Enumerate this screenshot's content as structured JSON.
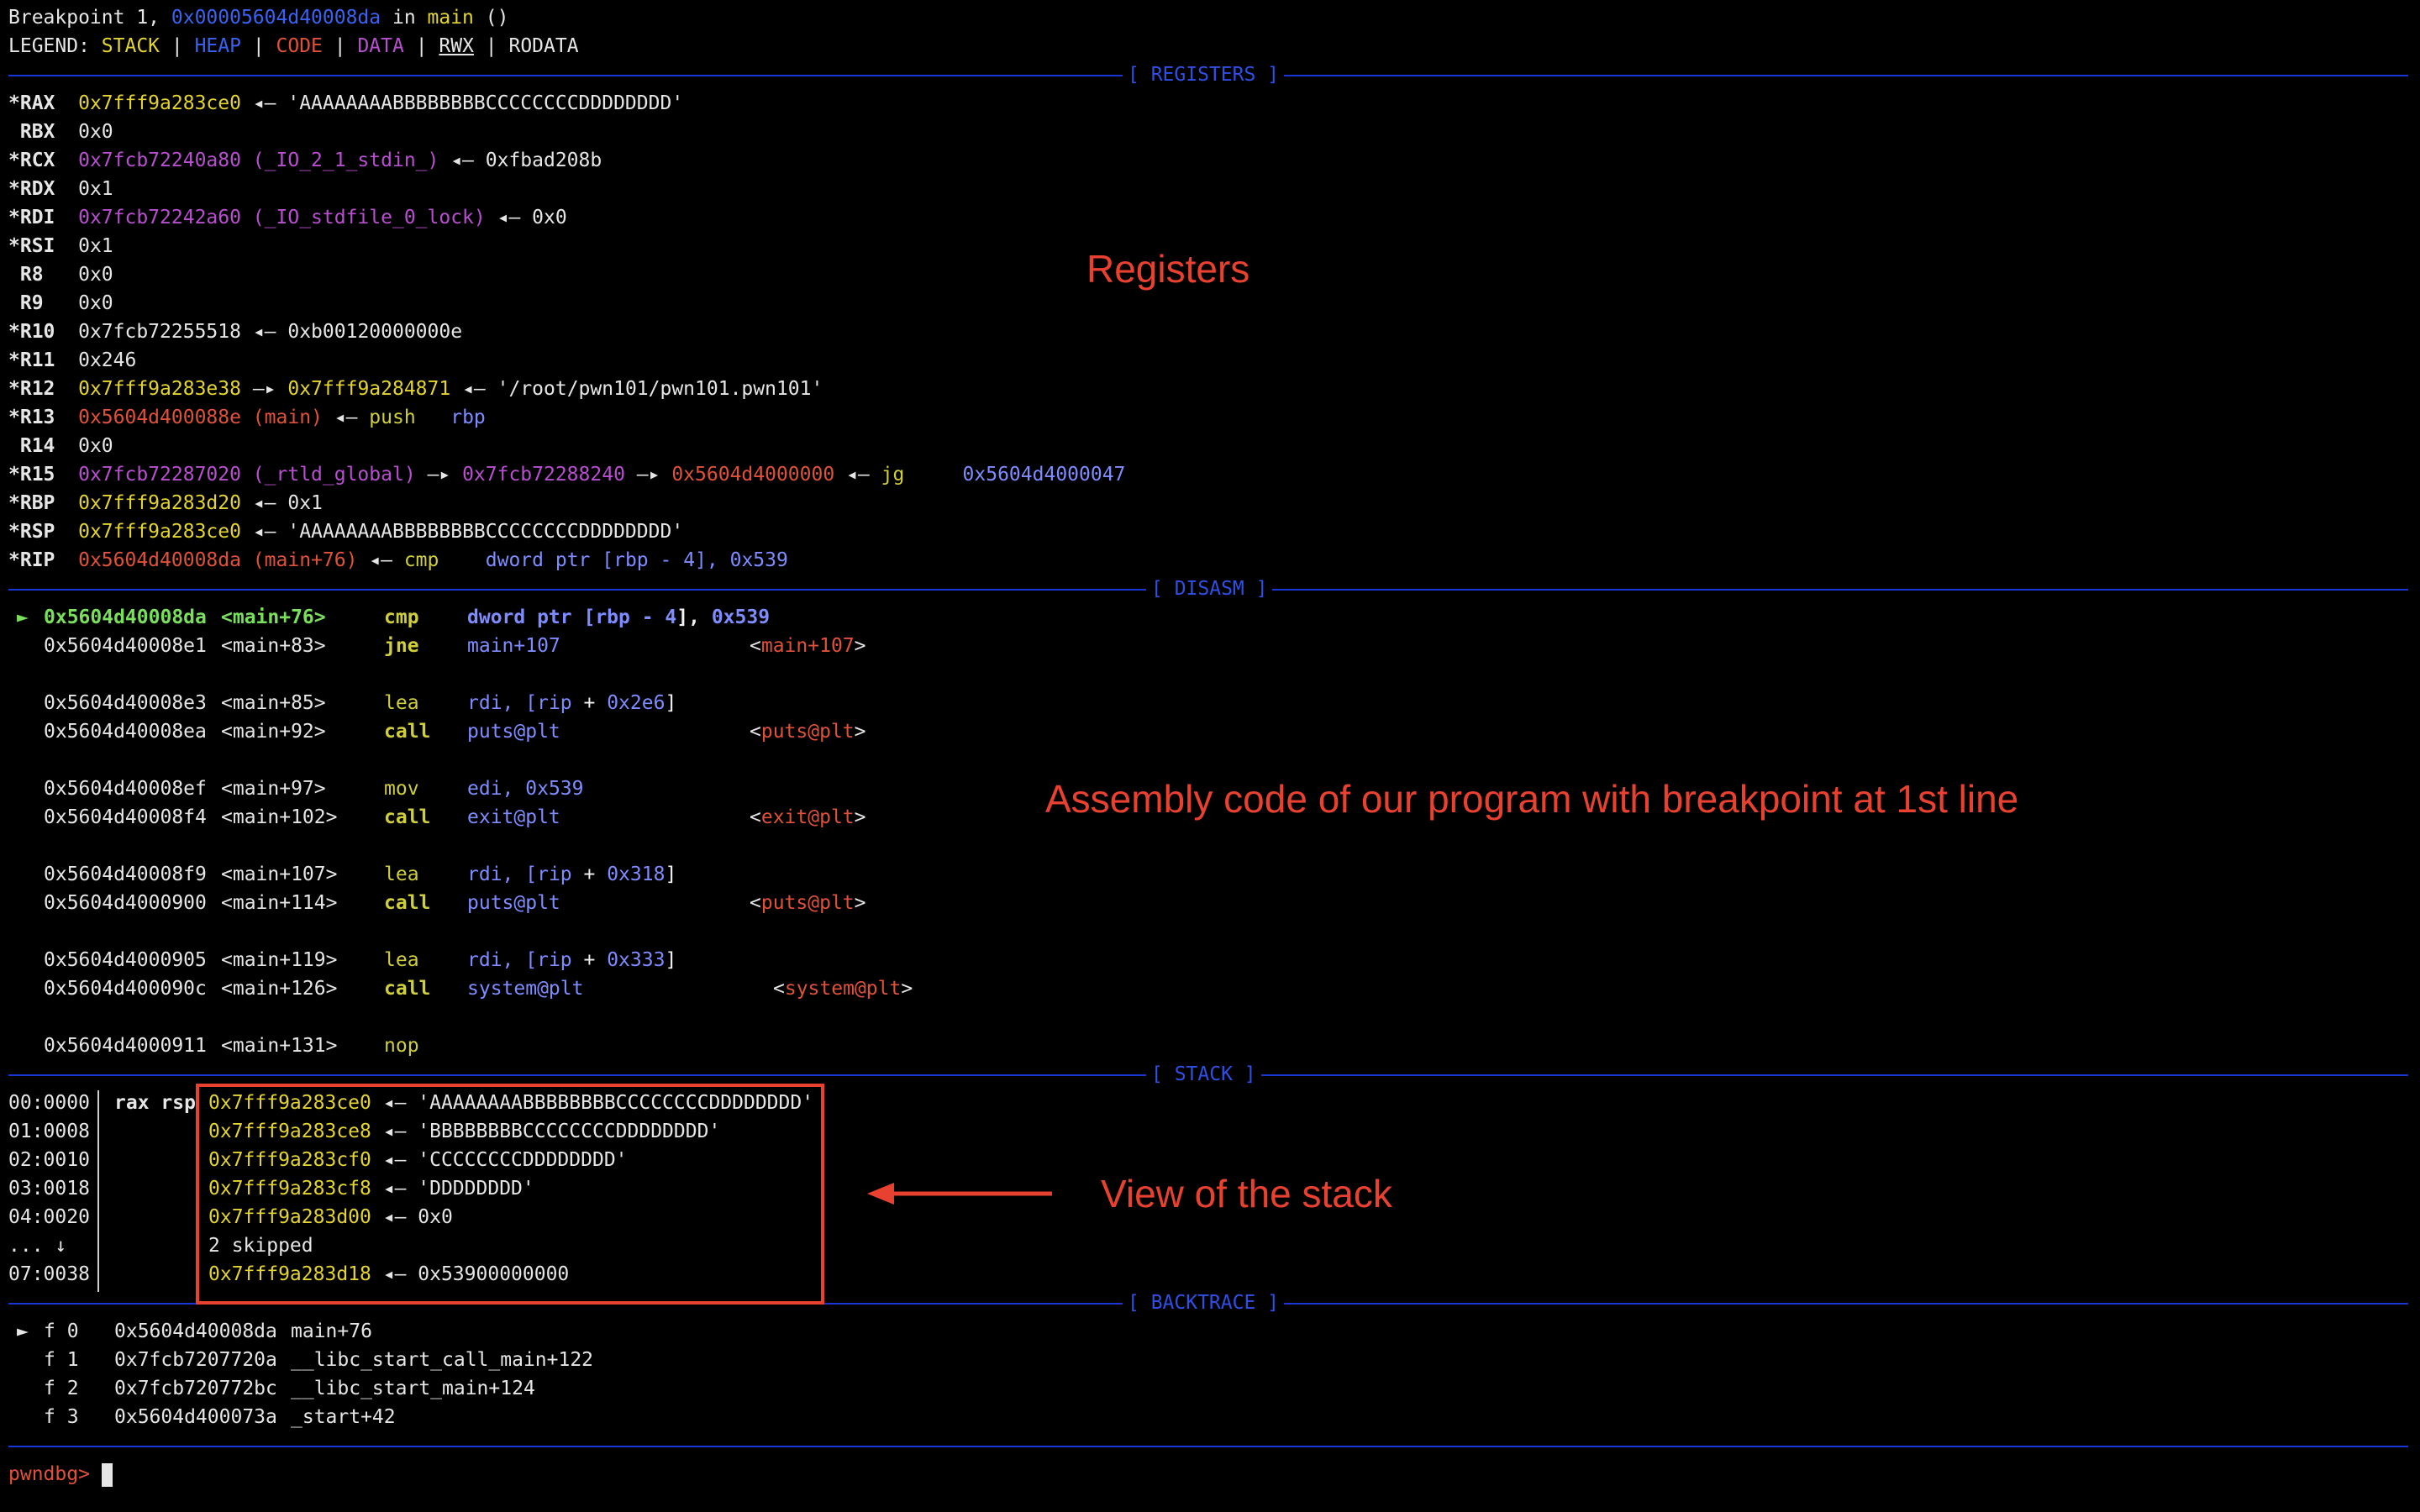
{
  "header": {
    "bp_prefix": "Breakpoint 1, ",
    "bp_addr": "0x00005604d40008da",
    "bp_in": " in ",
    "bp_func": "main",
    "bp_args": " ()",
    "legend_prefix": "LEGEND: ",
    "legend_stack": "STACK",
    "legend_heap": "HEAP",
    "legend_code": "CODE",
    "legend_data": "DATA",
    "legend_rwx": "RWX",
    "legend_rodata": "RODATA",
    "legend_sep": " | "
  },
  "sections": {
    "registers": "[ REGISTERS ]",
    "disasm": "[ DISASM ]",
    "stack": "[ STACK ]",
    "backtrace": "[ BACKTRACE ]"
  },
  "registers": {
    "rax": {
      "name": "*RAX",
      "v1": "0x7fff9a283ce0",
      "arrow": " ◂— ",
      "v2": "'AAAAAAAABBBBBBBBCCCCCCCCDDDDDDDD'"
    },
    "rbx": {
      "name": " RBX",
      "v1": "0x0"
    },
    "rcx": {
      "name": "*RCX",
      "v1": "0x7fcb72240a80 (_IO_2_1_stdin_)",
      "arrow": " ◂— ",
      "v2": "0xfbad208b"
    },
    "rdx": {
      "name": "*RDX",
      "v1": "0x1"
    },
    "rdi": {
      "name": "*RDI",
      "v1": "0x7fcb72242a60 (_IO_stdfile_0_lock)",
      "arrow": " ◂— ",
      "v2": "0x0"
    },
    "rsi": {
      "name": "*RSI",
      "v1": "0x1"
    },
    "r8": {
      "name": " R8",
      "v1": "0x0"
    },
    "r9": {
      "name": " R9",
      "v1": "0x0"
    },
    "r10": {
      "name": "*R10",
      "v1": "0x7fcb72255518",
      "arrow": " ◂— ",
      "v2": "0xb00120000000e"
    },
    "r11": {
      "name": "*R11",
      "v1": "0x246"
    },
    "r12": {
      "name": "*R12",
      "v1": "0x7fff9a283e38",
      "a1": " —▸ ",
      "v2": "0x7fff9a284871",
      "a2": " ◂— ",
      "v3": "'/root/pwn101/pwn101.pwn101'"
    },
    "r13": {
      "name": "*R13",
      "v1": "0x5604d400088e (main)",
      "arrow": " ◂— ",
      "v2": "push",
      "v3": "rbp"
    },
    "r14": {
      "name": " R14",
      "v1": "0x0"
    },
    "r15": {
      "name": "*R15",
      "v1": "0x7fcb72287020 (_rtld_global)",
      "a1": " —▸ ",
      "v2": "0x7fcb72288240",
      "a2": " —▸ ",
      "v3": "0x5604d4000000",
      "a3": " ◂— ",
      "v4": "jg",
      "v5": "0x5604d4000047"
    },
    "rbp": {
      "name": "*RBP",
      "v1": "0x7fff9a283d20",
      "arrow": " ◂— ",
      "v2": "0x1"
    },
    "rsp": {
      "name": "*RSP",
      "v1": "0x7fff9a283ce0",
      "arrow": " ◂— ",
      "v2": "'AAAAAAAABBBBBBBBCCCCCCCCDDDDDDDD'"
    },
    "rip": {
      "name": "*RIP",
      "v1": "0x5604d40008da (main+76)",
      "arrow": " ◂— ",
      "v2": "cmp",
      "v3": "dword ptr [",
      "v4": "rbp",
      "v5": " - ",
      "v6": "4",
      "v7": "], ",
      "v8": "0x539"
    }
  },
  "disasm": {
    "marker": "►",
    "l1": {
      "addr": "0x5604d40008da",
      "sym": "<main+76>",
      "mn": "cmp",
      "a": "dword ptr [",
      "b": "rbp",
      "c": " - ",
      "d": "4",
      "e": "], ",
      "f": "0x539"
    },
    "l2": {
      "addr": "0x5604d40008e1",
      "sym": "<main+83>",
      "mn": "jne",
      "op": "main+107",
      "lt": "<",
      "tgt": "main+107",
      "gt": ">"
    },
    "l3": {
      "addr": "0x5604d40008e3",
      "sym": "<main+85>",
      "mn": "lea",
      "a": "rdi, [",
      "b": "rip",
      "c": " + ",
      "d": "0x2e6",
      "e": "]"
    },
    "l4": {
      "addr": "0x5604d40008ea",
      "sym": "<main+92>",
      "mn": "call",
      "op": "puts@plt",
      "lt": "<",
      "tgt": "puts@plt",
      "gt": ">"
    },
    "l5": {
      "addr": "0x5604d40008ef",
      "sym": "<main+97>",
      "mn": "mov",
      "a": "edi, ",
      "d": "0x539"
    },
    "l6": {
      "addr": "0x5604d40008f4",
      "sym": "<main+102>",
      "mn": "call",
      "op": "exit@plt",
      "lt": "<",
      "tgt": "exit@plt",
      "gt": ">"
    },
    "l7": {
      "addr": "0x5604d40008f9",
      "sym": "<main+107>",
      "mn": "lea",
      "a": "rdi, [",
      "b": "rip",
      "c": " + ",
      "d": "0x318",
      "e": "]"
    },
    "l8": {
      "addr": "0x5604d4000900",
      "sym": "<main+114>",
      "mn": "call",
      "op": "puts@plt",
      "lt": "<",
      "tgt": "puts@plt",
      "gt": ">"
    },
    "l9": {
      "addr": "0x5604d4000905",
      "sym": "<main+119>",
      "mn": "lea",
      "a": "rdi, [",
      "b": "rip",
      "c": " + ",
      "d": "0x333",
      "e": "]"
    },
    "l10": {
      "addr": "0x5604d400090c",
      "sym": "<main+126>",
      "mn": "call",
      "op": "system@plt",
      "lt": "<",
      "tgt": "system@plt",
      "gt": ">"
    },
    "l11": {
      "addr": "0x5604d4000911",
      "sym": "<main+131>",
      "mn": "nop"
    }
  },
  "stack": {
    "s0": {
      "off": "00:0000",
      "regs": "rax rsp",
      "addr": "0x7fff9a283ce0",
      "arrow": " ◂— ",
      "val": "'AAAAAAAABBBBBBBBCCCCCCCCDDDDDDDD'"
    },
    "s1": {
      "off": "01:0008",
      "addr": "0x7fff9a283ce8",
      "arrow": " ◂— ",
      "val": "'BBBBBBBBCCCCCCCCDDDDDDDD'"
    },
    "s2": {
      "off": "02:0010",
      "addr": "0x7fff9a283cf0",
      "arrow": " ◂— ",
      "val": "'CCCCCCCCDDDDDDDD'"
    },
    "s3": {
      "off": "03:0018",
      "addr": "0x7fff9a283cf8",
      "arrow": " ◂— ",
      "val": "'DDDDDDDD'"
    },
    "s4": {
      "off": "04:0020",
      "addr": "0x7fff9a283d00",
      "arrow": " ◂— ",
      "val": "0x0"
    },
    "skip": {
      "off": "... ↓",
      "val": "2 skipped"
    },
    "s7": {
      "off": "07:0038",
      "addr": "0x7fff9a283d18",
      "arrow": " ◂— ",
      "val": "0x53900000000"
    }
  },
  "backtrace": {
    "marker": "►",
    "f0": {
      "f": "f 0",
      "addr": "0x5604d40008da",
      "sym": "main+76"
    },
    "f1": {
      "f": "f 1",
      "addr": "0x7fcb7207720a",
      "sym": "__libc_start_call_main+122"
    },
    "f2": {
      "f": "f 2",
      "addr": "0x7fcb720772bc",
      "sym": "__libc_start_main+124"
    },
    "f3": {
      "f": "f 3",
      "addr": "0x5604d400073a",
      "sym": "_start+42"
    }
  },
  "prompt": "pwndbg> ",
  "annotations": {
    "registers": "Registers",
    "asm": "Assembly code of our program with breakpoint at 1st line",
    "stack": "View of the stack"
  },
  "colors": {
    "accent_blue": "#1a35d6",
    "stack_yellow": "#e3d430",
    "heap_blue": "#3a62f2",
    "code_red": "#e0513a",
    "data_purple": "#b84fd0",
    "annotation_red": "#e8412f"
  }
}
